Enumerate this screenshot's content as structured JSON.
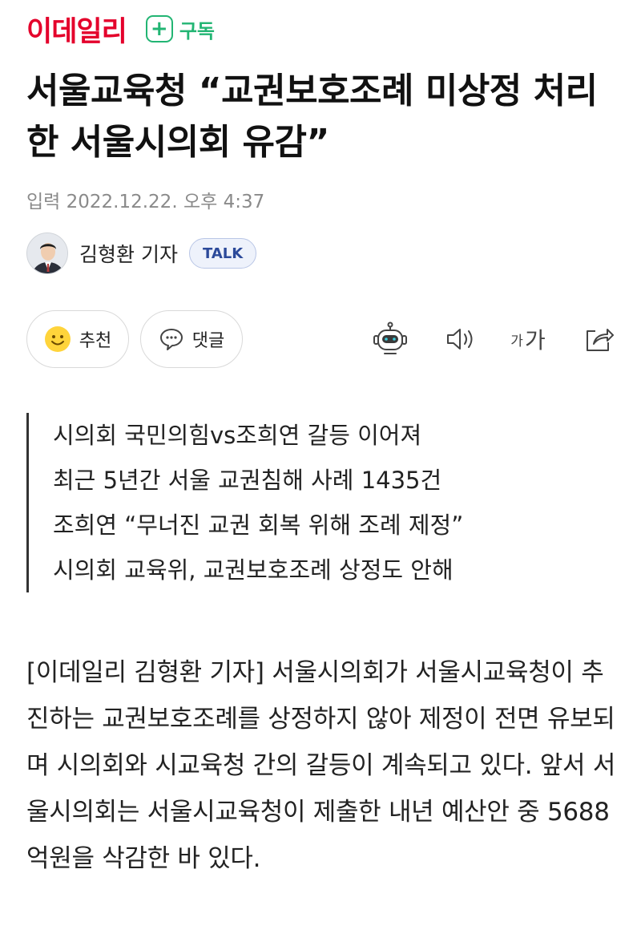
{
  "header": {
    "logo": "이데일리",
    "subscribe_label": "구독",
    "subscribe_icon": "plus-icon"
  },
  "article": {
    "headline": "서울교육청 “교권보호조례 미상정 처리한 서울시의회 유감”",
    "timestamp": "입력 2022.12.22. 오후 4:37",
    "reporter_name": "김형환 기자",
    "talk_label": "TALK"
  },
  "actions": {
    "recommend_label": "추천",
    "comment_label": "댓글",
    "font_small": "가",
    "font_large": "가",
    "icons": [
      "smiley-icon",
      "speech-bubble-icon",
      "robot-icon",
      "speaker-icon",
      "font-size-icon",
      "share-icon"
    ]
  },
  "summary": [
    "시의회 국민의힘vs조희연 갈등 이어져",
    "최근 5년간 서울 교권침해 사례 1435건",
    "조희연 “무너진 교권 회복 위해 조례 제정”",
    "시의회 교육위, 교권보호조례 상정도 안해"
  ],
  "body": "[이데일리 김형환 기자] 서울시의회가 서울시교육청이 추진하는 교권보호조례를 상정하지 않아 제정이 전면 유보되며 시의회와 시교육청 간의 갈등이 계속되고 있다. 앞서 서울시의회는 서울시교육청이 제출한 내년 예산안 중 5688억원을 삭감한 바 있다.",
  "colors": {
    "brand": "#e4002b",
    "subscribe": "#22b573",
    "talk_badge": "#2c4a9a",
    "timestamp": "#8a8a8a"
  }
}
